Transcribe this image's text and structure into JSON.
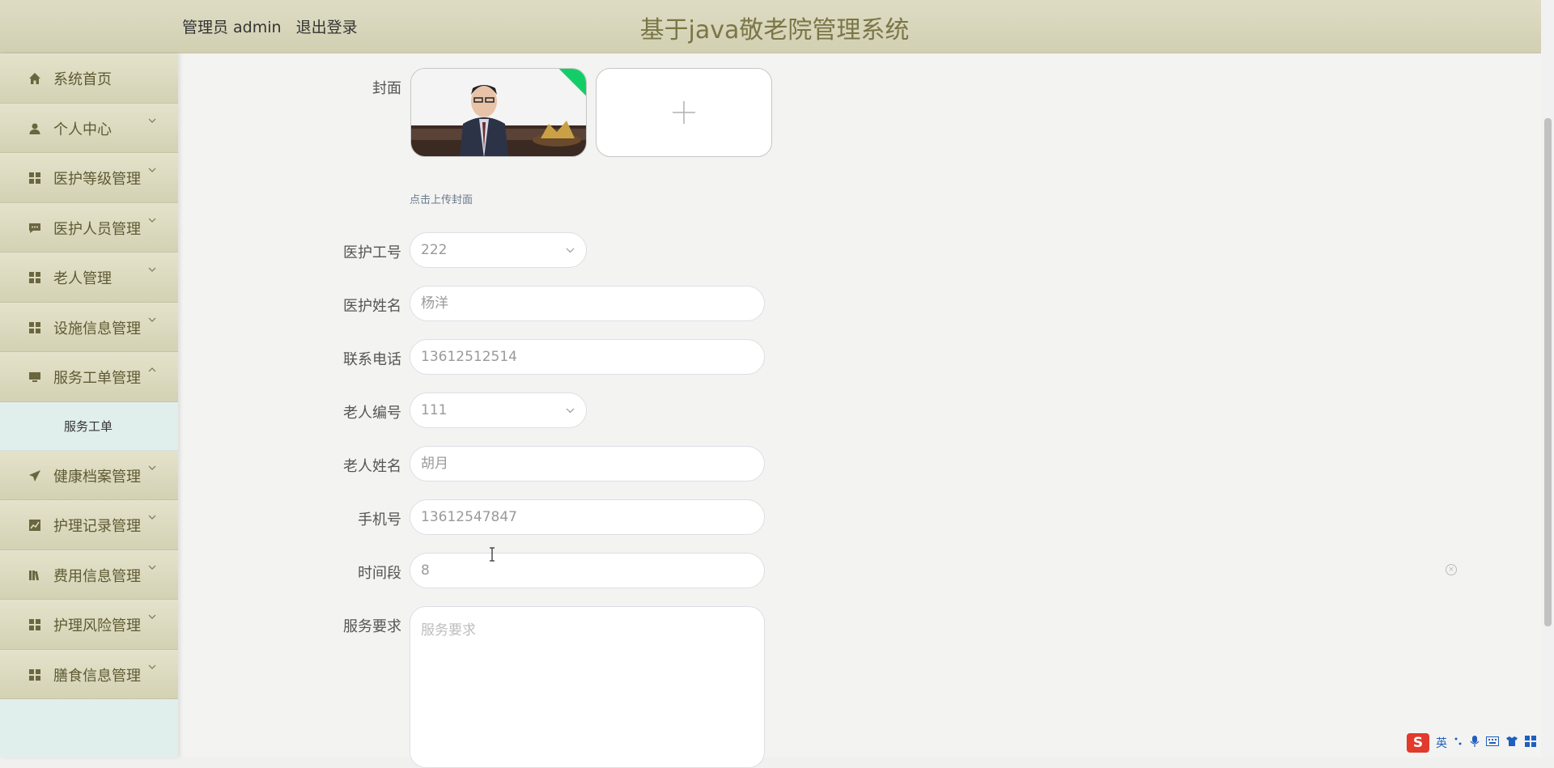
{
  "header": {
    "user_label": "管理员 admin",
    "logout_label": "退出登录",
    "system_title": "基于java敬老院管理系统"
  },
  "sidebar": {
    "items": [
      {
        "label": "系统首页",
        "icon": "home-icon",
        "has_arrow": false
      },
      {
        "label": "个人中心",
        "icon": "user-icon",
        "has_arrow": true
      },
      {
        "label": "医护等级管理",
        "icon": "grid-icon",
        "has_arrow": true
      },
      {
        "label": "医护人员管理",
        "icon": "chat-icon",
        "has_arrow": true
      },
      {
        "label": "老人管理",
        "icon": "grid-icon",
        "has_arrow": true
      },
      {
        "label": "设施信息管理",
        "icon": "grid-icon",
        "has_arrow": true
      },
      {
        "label": "服务工单管理",
        "icon": "monitor-icon",
        "has_arrow": true,
        "expanded": true
      },
      {
        "label": "健康档案管理",
        "icon": "send-icon",
        "has_arrow": true
      },
      {
        "label": "护理记录管理",
        "icon": "chart-icon",
        "has_arrow": true
      },
      {
        "label": "费用信息管理",
        "icon": "book-icon",
        "has_arrow": true
      },
      {
        "label": "护理风险管理",
        "icon": "grid-icon",
        "has_arrow": true
      },
      {
        "label": "膳食信息管理",
        "icon": "grid-icon",
        "has_arrow": true
      }
    ],
    "submenu": {
      "label": "服务工单"
    }
  },
  "form": {
    "cover_label": "封面",
    "upload_tip": "点击上传封面",
    "fields": {
      "staff_no": {
        "label": "医护工号",
        "value": "222"
      },
      "staff_name": {
        "label": "医护姓名",
        "value": "杨洋"
      },
      "contact_phone": {
        "label": "联系电话",
        "value": "13612512514"
      },
      "elder_no": {
        "label": "老人编号",
        "value": "111"
      },
      "elder_name": {
        "label": "老人姓名",
        "value": "胡月"
      },
      "mobile": {
        "label": "手机号",
        "value": "13612547847"
      },
      "time_slot": {
        "label": "时间段",
        "value": "8"
      },
      "service_req": {
        "label": "服务要求",
        "placeholder": "服务要求"
      }
    }
  },
  "ime": {
    "logo": "S",
    "mode": "英"
  },
  "colors": {
    "header_bg": "#d6d4b8",
    "title_text": "#7a7646",
    "menu_text": "#5e5a34",
    "submenu_bg": "#e1efec",
    "upload_success": "#13ce66"
  }
}
